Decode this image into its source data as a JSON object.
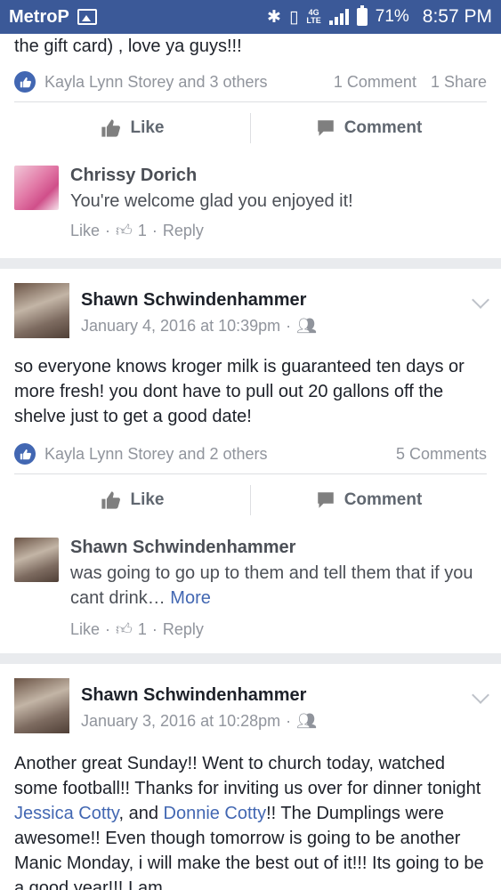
{
  "status": {
    "carrier": "MetroP",
    "net_top": "4G",
    "net_bottom": "LTE",
    "battery": "71%",
    "time": "8:57 PM"
  },
  "post1": {
    "text_tail": "the gift card) , love ya guys!!!",
    "reactions": "Kayla Lynn Storey and 3 others",
    "comments": "1 Comment",
    "shares": "1 Share",
    "like_label": "Like",
    "comment_label": "Comment",
    "comment": {
      "author": "Chrissy Dorich",
      "text": "You're welcome glad you enjoyed it!",
      "like": "Like",
      "like_count": "1",
      "reply": "Reply"
    }
  },
  "post2": {
    "author": "Shawn Schwindenhammer",
    "date": "January 4, 2016 at 10:39pm",
    "text": "so everyone knows kroger milk is guaranteed ten days or more fresh! you dont have to pull out 20 gallons off the shelve just to get a good date!",
    "reactions": "Kayla Lynn Storey and 2 others",
    "comments": "5 Comments",
    "like_label": "Like",
    "comment_label": "Comment",
    "comment": {
      "author": "Shawn Schwindenhammer",
      "text": "was going to go up to them and tell them that if you cant drink…",
      "more": "More",
      "like": "Like",
      "like_count": "1",
      "reply": "Reply"
    }
  },
  "post3": {
    "author": "Shawn Schwindenhammer",
    "date": "January 3, 2016 at 10:28pm",
    "text_a": "Another great Sunday!! Went to church today, watched some football!! Thanks for inviting us over for dinner tonight ",
    "link1": "Jessica Cotty",
    "text_b": ", and ",
    "link2": "Donnie Cotty",
    "text_c": "!! The Dumplings were awesome!! Even though tomorrow is going to be another Manic Monday, i will make the best out of it!!! Its going to be a good year!!! I am"
  }
}
